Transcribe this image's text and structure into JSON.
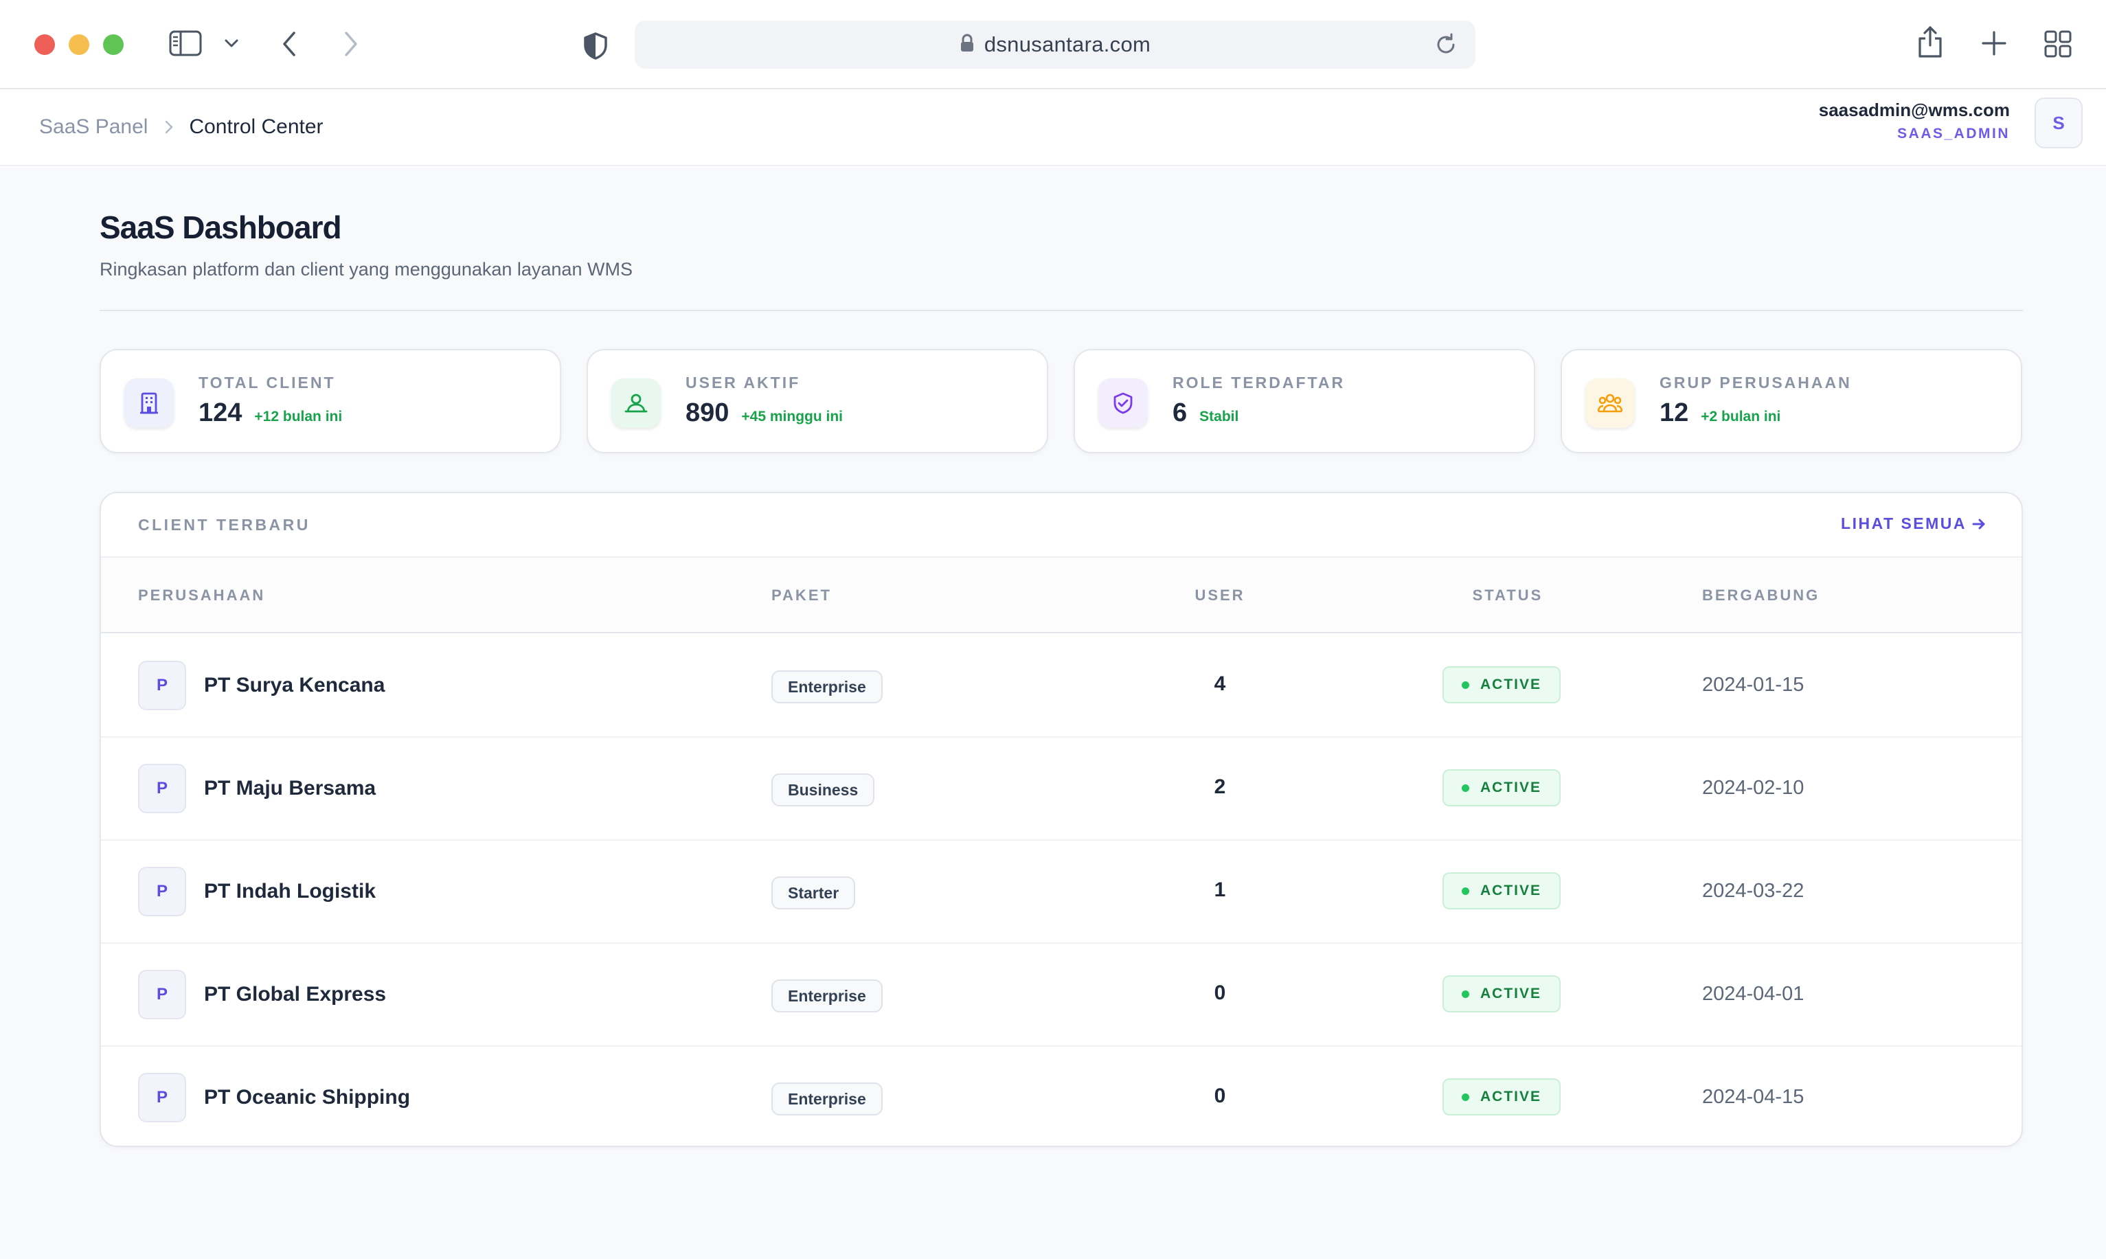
{
  "browser": {
    "url": "dsnusantara.com"
  },
  "breadcrumb": {
    "root": "SaaS Panel",
    "current": "Control Center"
  },
  "user": {
    "email": "saasadmin@wms.com",
    "role": "SAAS_ADMIN",
    "avatar_initial": "S"
  },
  "page": {
    "title": "SaaS Dashboard",
    "subtitle": "Ringkasan platform dan client yang menggunakan layanan WMS"
  },
  "stats": [
    {
      "label": "TOTAL CLIENT",
      "value": "124",
      "delta": "+12 bulan ini",
      "icon": "building-icon",
      "color": "#5b4de0",
      "bg": "#eef0fb"
    },
    {
      "label": "USER AKTIF",
      "value": "890",
      "delta": "+45 minggu ini",
      "icon": "user-icon",
      "color": "#16a34a",
      "bg": "#e9f8ee"
    },
    {
      "label": "ROLE TERDAFTAR",
      "value": "6",
      "delta": "Stabil",
      "icon": "shield-icon",
      "color": "#7c3aed",
      "bg": "#f3eefe"
    },
    {
      "label": "GRUP PERUSAHAAN",
      "value": "12",
      "delta": "+2 bulan ini",
      "icon": "group-icon",
      "color": "#f59e0b",
      "bg": "#fef6e4"
    }
  ],
  "clients": {
    "section_title": "CLIENT TERBARU",
    "see_all": "LIHAT SEMUA",
    "columns": [
      "PERUSAHAAN",
      "PAKET",
      "USER",
      "STATUS",
      "BERGABUNG"
    ],
    "rows": [
      {
        "initial": "P",
        "name": "PT Surya Kencana",
        "plan": "Enterprise",
        "users": "4",
        "status": "ACTIVE",
        "joined": "2024-01-15"
      },
      {
        "initial": "P",
        "name": "PT Maju Bersama",
        "plan": "Business",
        "users": "2",
        "status": "ACTIVE",
        "joined": "2024-02-10"
      },
      {
        "initial": "P",
        "name": "PT Indah Logistik",
        "plan": "Starter",
        "users": "1",
        "status": "ACTIVE",
        "joined": "2024-03-22"
      },
      {
        "initial": "P",
        "name": "PT Global Express",
        "plan": "Enterprise",
        "users": "0",
        "status": "ACTIVE",
        "joined": "2024-04-01"
      },
      {
        "initial": "P",
        "name": "PT Oceanic Shipping",
        "plan": "Enterprise",
        "users": "0",
        "status": "ACTIVE",
        "joined": "2024-04-15"
      }
    ]
  }
}
